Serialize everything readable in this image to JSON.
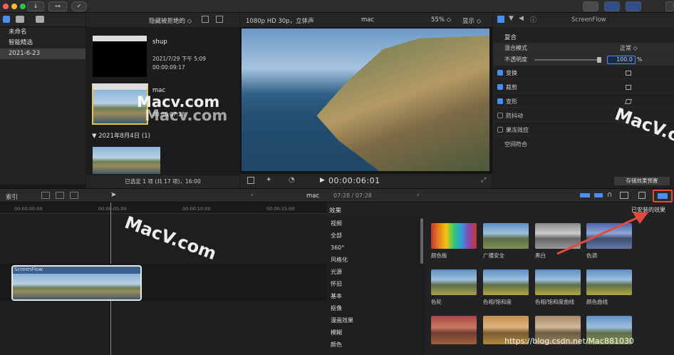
{
  "toolbar": {
    "download_icon": "↓",
    "key_icon": "⊶",
    "check_icon": "✓",
    "right_icons": [
      "grid-icon",
      "list-icon",
      "timeline-icon"
    ]
  },
  "library": {
    "items": [
      "未命名",
      "智能精选",
      "2021-6-23"
    ]
  },
  "browser": {
    "filter_label": "隐藏被拒绝的 ◇",
    "clips": [
      {
        "name": "shup",
        "date": "2021/7/29 下午 5:09",
        "duration": "00:00:09:17"
      },
      {
        "name": "mac",
        "date": "",
        "duration": "00:00:07:28"
      }
    ],
    "group_header": "▼ 2021年8月4日 (1)",
    "status": "已选定 1 项 (共 17 项)，16:00"
  },
  "viewer": {
    "format": "1080p HD 30p，立体声",
    "clip": "mac",
    "zoom": "55% ◇",
    "display": "显示 ◇",
    "timecode": "00:00:06:01"
  },
  "inspector": {
    "clip_title": "ScreenFlow",
    "section": "复合",
    "blend_label": "混合模式",
    "blend_value": "正常 ◇",
    "opacity_label": "不透明度",
    "opacity_value": "100.0",
    "opacity_unit": "%",
    "rows": [
      {
        "label": "变换",
        "checked": true
      },
      {
        "label": "裁剪",
        "checked": true
      },
      {
        "label": "变形",
        "checked": true
      },
      {
        "label": "防抖动",
        "checked": false
      },
      {
        "label": "果冻效应",
        "checked": false
      }
    ],
    "spatial": "空间符合",
    "save_preset": "存储效果预置"
  },
  "timeline_bar": {
    "index": "索引",
    "project": "mac",
    "duration": "07:28 / 07:28"
  },
  "ruler": [
    "00:00:00:00",
    "00:00:05:00",
    "00:00:10:00",
    "00:00:15:00"
  ],
  "timeline_clip": "ScreenFlow",
  "effects": {
    "title": "效果",
    "installed": "已安装的效果",
    "categories": [
      "视频",
      "全部",
      "360°",
      "风格化",
      "光源",
      "怀旧",
      "基本",
      "抠像",
      "漫画效果",
      "模糊",
      "颜色"
    ],
    "items": [
      "颜色板",
      "广播安全",
      "黑白",
      "色调",
      "色轮",
      "色相/饱和度",
      "色相/饱和度曲线",
      "颜色曲线",
      "",
      "",
      "",
      ""
    ]
  },
  "watermarks": [
    "Macv.com",
    "Macv.com",
    "MacV.com",
    "MacV.com",
    "https://blog.csdn.net/Mac881030"
  ],
  "colors": {
    "accent": "#4a8ff0",
    "highlight": "#e24a3b",
    "selection": "#e6c44a"
  }
}
